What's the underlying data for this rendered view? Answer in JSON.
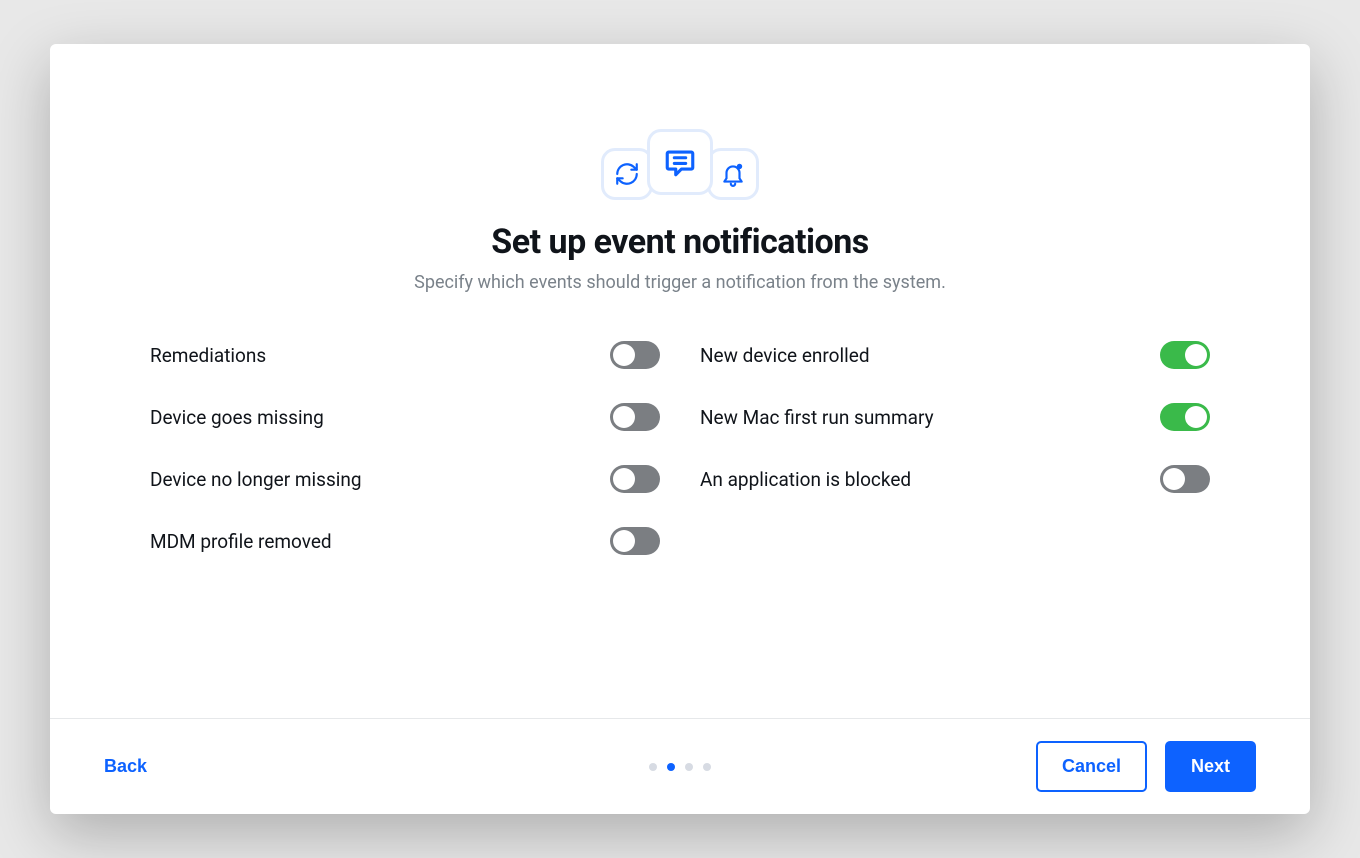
{
  "header": {
    "title": "Set up event notifications",
    "subtitle": "Specify which events should trigger a notification from the system."
  },
  "toggles": {
    "left": [
      {
        "label": "Remediations",
        "enabled": false
      },
      {
        "label": "Device goes missing",
        "enabled": false
      },
      {
        "label": "Device no longer missing",
        "enabled": false
      },
      {
        "label": "MDM profile removed",
        "enabled": false
      }
    ],
    "right": [
      {
        "label": "New device enrolled",
        "enabled": true
      },
      {
        "label": "New Mac first run summary",
        "enabled": true
      },
      {
        "label": "An application is blocked",
        "enabled": false
      }
    ]
  },
  "pager": {
    "total": 4,
    "active": 1
  },
  "footer": {
    "back_label": "Back",
    "cancel_label": "Cancel",
    "next_label": "Next"
  },
  "colors": {
    "accent": "#0d62ff",
    "toggle_on": "#3aba4a",
    "toggle_off": "#7b7e82"
  }
}
